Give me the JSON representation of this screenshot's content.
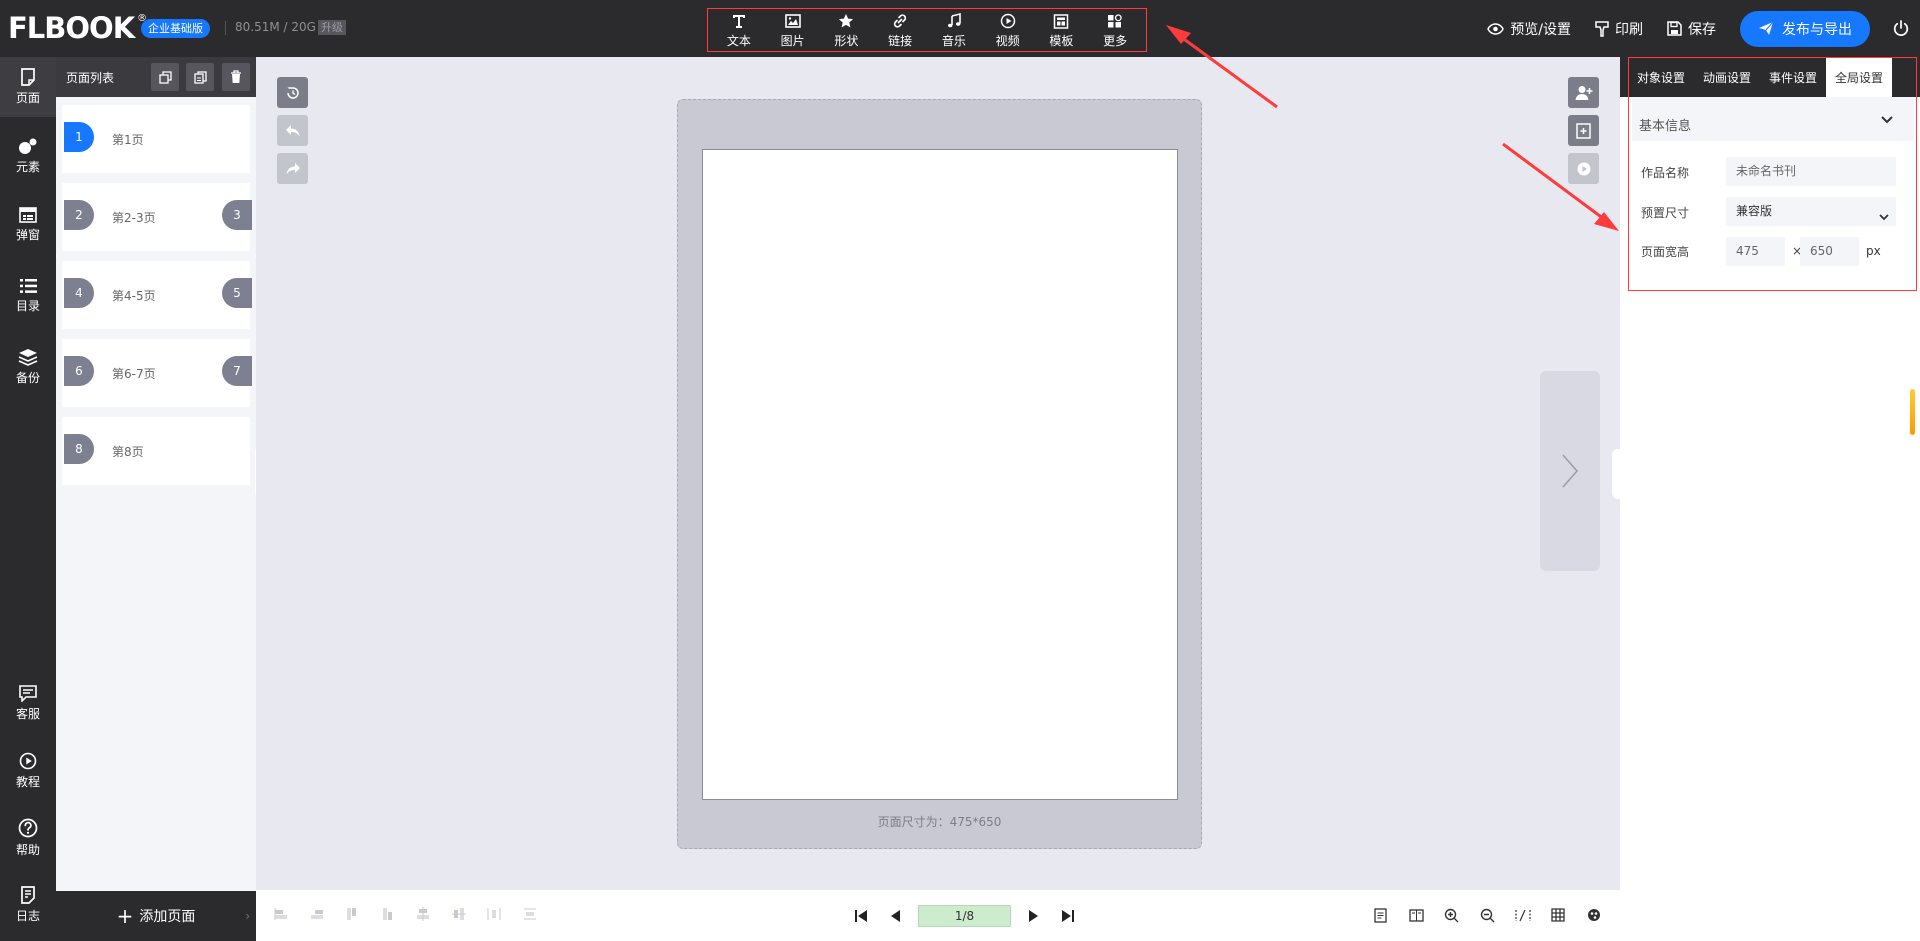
{
  "header": {
    "logo_text": "FLBOOK",
    "logo_reg": "®",
    "edition": "企业基础版",
    "storage": "80.51M / 20G",
    "upgrade": "升级",
    "tools": [
      {
        "label": "文本",
        "icon": "text-icon"
      },
      {
        "label": "图片",
        "icon": "image-icon"
      },
      {
        "label": "形状",
        "icon": "star-icon"
      },
      {
        "label": "链接",
        "icon": "link-icon"
      },
      {
        "label": "音乐",
        "icon": "music-icon"
      },
      {
        "label": "视频",
        "icon": "video-icon"
      },
      {
        "label": "模板",
        "icon": "template-icon"
      },
      {
        "label": "更多",
        "icon": "more-icon"
      }
    ],
    "preview": "预览/设置",
    "print": "印刷",
    "save": "保存",
    "publish": "发布与导出"
  },
  "sidebar": {
    "items": [
      {
        "label": "页面",
        "icon": "page-icon"
      },
      {
        "label": "元素",
        "icon": "elements-icon"
      },
      {
        "label": "弹窗",
        "icon": "popup-icon"
      },
      {
        "label": "目录",
        "icon": "list-icon"
      },
      {
        "label": "备份",
        "icon": "layers-icon"
      }
    ],
    "bottom_items": [
      {
        "label": "客服",
        "icon": "chat-icon"
      },
      {
        "label": "教程",
        "icon": "play-circle-icon"
      },
      {
        "label": "帮助",
        "icon": "help-icon"
      },
      {
        "label": "日志",
        "icon": "log-icon"
      }
    ]
  },
  "page_list": {
    "title": "页面列表",
    "pages": [
      {
        "num": "1",
        "label": "第1页",
        "num2": ""
      },
      {
        "num": "2",
        "label": "第2-3页",
        "num2": "3"
      },
      {
        "num": "4",
        "label": "第4-5页",
        "num2": "5"
      },
      {
        "num": "6",
        "label": "第6-7页",
        "num2": "7"
      },
      {
        "num": "8",
        "label": "第8页",
        "num2": ""
      }
    ],
    "add_page": "添加页面"
  },
  "canvas": {
    "page_size_text": "页面尺寸为：475*650"
  },
  "bottom": {
    "pager_value": "1/8"
  },
  "right_panel": {
    "tabs": [
      "对象设置",
      "动画设置",
      "事件设置",
      "全局设置"
    ],
    "section_title": "基本信息",
    "fields": {
      "name_label": "作品名称",
      "name_placeholder": "未命名书刊",
      "size_label": "预置尺寸",
      "size_value": "兼容版",
      "wh_label": "页面宽高",
      "width": "475",
      "times": "×",
      "height": "650",
      "unit": "px"
    }
  },
  "colors": {
    "accent": "#1677ff",
    "dark": "#2b2b2e",
    "annotation": "#ff3b3b"
  }
}
